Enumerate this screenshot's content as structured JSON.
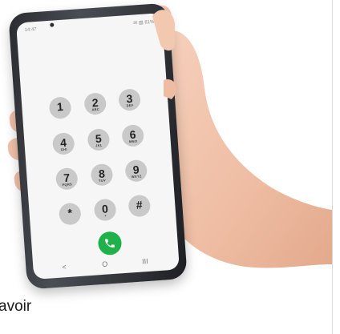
{
  "status_bar": {
    "time": "14:47",
    "icons": "✉ ▨ 81%"
  },
  "dialer": {
    "keys": [
      {
        "digit": "1",
        "letters": ""
      },
      {
        "digit": "2",
        "letters": "ABC"
      },
      {
        "digit": "3",
        "letters": "DEF"
      },
      {
        "digit": "4",
        "letters": "GHI"
      },
      {
        "digit": "5",
        "letters": "JKL"
      },
      {
        "digit": "6",
        "letters": "MNO"
      },
      {
        "digit": "7",
        "letters": "PQRS"
      },
      {
        "digit": "8",
        "letters": "TUV"
      },
      {
        "digit": "9",
        "letters": "WXYZ"
      },
      {
        "digit": "*",
        "letters": ""
      },
      {
        "digit": "0",
        "letters": "+"
      },
      {
        "digit": "#",
        "letters": ""
      }
    ],
    "call_icon": "phone-icon"
  },
  "nav": {
    "back": "<",
    "home": "O",
    "recent": "III"
  },
  "caption": {
    "line1": "avoir",
    "line2": "— — —"
  },
  "colors": {
    "call_green": "#21b14a",
    "key_grey": "#c9c9c9",
    "screen_bg": "#f6f6f6",
    "phone_frame": "#2a2c31",
    "skin": "#f1c2aa"
  }
}
